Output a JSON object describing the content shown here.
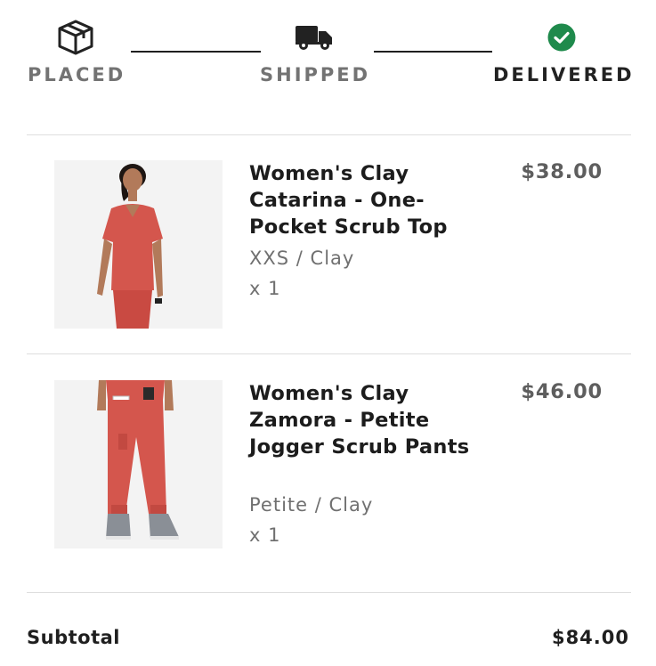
{
  "tracker": {
    "stages": [
      {
        "label": "PLACED",
        "icon": "package-box-icon",
        "status": "done"
      },
      {
        "label": "SHIPPED",
        "icon": "delivery-truck-icon",
        "status": "done"
      },
      {
        "label": "DELIVERED",
        "icon": "check-circle-icon",
        "status": "current"
      }
    ]
  },
  "items": [
    {
      "name": "Women's Clay Catarina - One-Pocket Scrub Top",
      "variant": "XXS / Clay",
      "quantity": "x 1",
      "price": "$38.00",
      "image": "product-photo-scrub-top"
    },
    {
      "name": "Women's Clay Zamora - Petite Jogger Scrub Pants",
      "variant": "Petite / Clay",
      "quantity": "x 1",
      "price": "$46.00",
      "image": "product-photo-jogger-pants"
    }
  ],
  "summary": {
    "subtotal_label": "Subtotal",
    "subtotal_value": "$84.00"
  },
  "colors": {
    "delivered_check": "#1f8a4c",
    "product_color": "#d4564d"
  }
}
